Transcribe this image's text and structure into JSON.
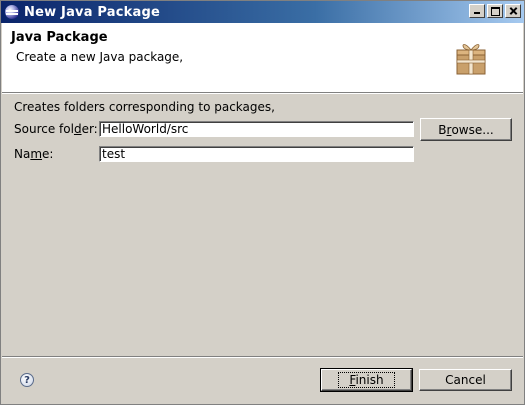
{
  "window": {
    "title": "New Java Package",
    "controls": [
      "minimize-icon",
      "maximize-icon",
      "close-icon"
    ]
  },
  "banner": {
    "title": "Java Package",
    "description": "Create a new Java package,",
    "icon": "package-icon"
  },
  "form": {
    "info": "Creates folders corresponding to packages,",
    "source_folder": {
      "label_pre": "Source fol",
      "label_mnemonic": "d",
      "label_post": "er:",
      "value": "HelloWorld/src"
    },
    "browse": {
      "label_pre": "B",
      "label_mnemonic": "r",
      "label_post": "owse..."
    },
    "name": {
      "label_pre": "Na",
      "label_mnemonic": "m",
      "label_post": "e:",
      "value": "test"
    }
  },
  "footer": {
    "help_icon": "help-icon",
    "help_glyph": "?",
    "finish": {
      "label_mnemonic": "F",
      "label_post": "inish"
    },
    "cancel": "Cancel"
  }
}
